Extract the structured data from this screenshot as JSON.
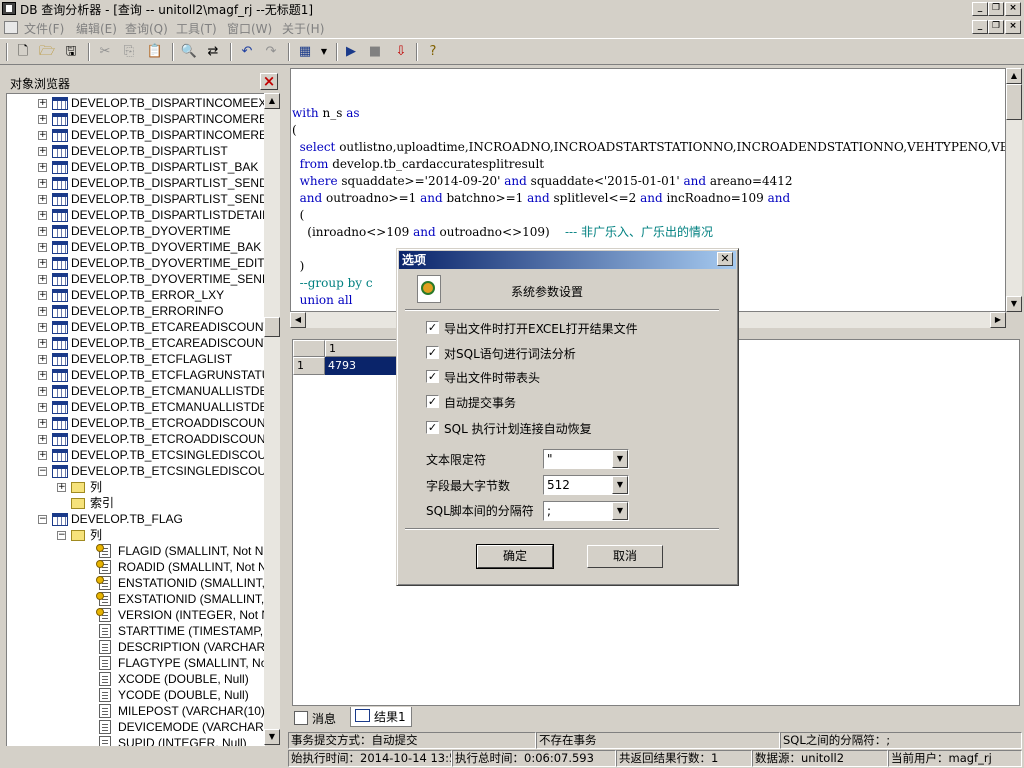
{
  "window": {
    "title": "DB 查询分析器 - [查询 -- unitoll2\\magf_rj  --无标题1]"
  },
  "menu": [
    "文件(F)",
    "编辑(E)",
    "查询(Q)",
    "工具(T)",
    "窗口(W)",
    "关于(H)"
  ],
  "object_browser": {
    "title": "对象浏览器",
    "items": [
      {
        "type": "table",
        "label": "DEVELOP.TB_DISPARTINCOMEEX",
        "level": 0,
        "exp": "+"
      },
      {
        "type": "table",
        "label": "DEVELOP.TB_DISPARTINCOMERE",
        "level": 0,
        "exp": "+"
      },
      {
        "type": "table",
        "label": "DEVELOP.TB_DISPARTINCOMERE",
        "level": 0,
        "exp": "+"
      },
      {
        "type": "table",
        "label": "DEVELOP.TB_DISPARTLIST",
        "level": 0,
        "exp": "+"
      },
      {
        "type": "table",
        "label": "DEVELOP.TB_DISPARTLIST_BAK",
        "level": 0,
        "exp": "+"
      },
      {
        "type": "table",
        "label": "DEVELOP.TB_DISPARTLIST_SEND",
        "level": 0,
        "exp": "+"
      },
      {
        "type": "table",
        "label": "DEVELOP.TB_DISPARTLIST_SEND",
        "level": 0,
        "exp": "+"
      },
      {
        "type": "table",
        "label": "DEVELOP.TB_DISPARTLISTDETAIL",
        "level": 0,
        "exp": "+"
      },
      {
        "type": "table",
        "label": "DEVELOP.TB_DYOVERTIME",
        "level": 0,
        "exp": "+"
      },
      {
        "type": "table",
        "label": "DEVELOP.TB_DYOVERTIME_BAK",
        "level": 0,
        "exp": "+"
      },
      {
        "type": "table",
        "label": "DEVELOP.TB_DYOVERTIME_EDIT",
        "level": 0,
        "exp": "+"
      },
      {
        "type": "table",
        "label": "DEVELOP.TB_DYOVERTIME_SEND",
        "level": 0,
        "exp": "+"
      },
      {
        "type": "table",
        "label": "DEVELOP.TB_ERROR_LXY",
        "level": 0,
        "exp": "+"
      },
      {
        "type": "table",
        "label": "DEVELOP.TB_ERRORINFO",
        "level": 0,
        "exp": "+"
      },
      {
        "type": "table",
        "label": "DEVELOP.TB_ETCAREADISCOUNT",
        "level": 0,
        "exp": "+"
      },
      {
        "type": "table",
        "label": "DEVELOP.TB_ETCAREADISCOUNT",
        "level": 0,
        "exp": "+"
      },
      {
        "type": "table",
        "label": "DEVELOP.TB_ETCFLAGLIST",
        "level": 0,
        "exp": "+"
      },
      {
        "type": "table",
        "label": "DEVELOP.TB_ETCFLAGRUNSTATU",
        "level": 0,
        "exp": "+"
      },
      {
        "type": "table",
        "label": "DEVELOP.TB_ETCMANUALLISTDE",
        "level": 0,
        "exp": "+"
      },
      {
        "type": "table",
        "label": "DEVELOP.TB_ETCMANUALLISTDE",
        "level": 0,
        "exp": "+"
      },
      {
        "type": "table",
        "label": "DEVELOP.TB_ETCROADDISCOUNT",
        "level": 0,
        "exp": "+"
      },
      {
        "type": "table",
        "label": "DEVELOP.TB_ETCROADDISCOUNT",
        "level": 0,
        "exp": "+"
      },
      {
        "type": "table",
        "label": "DEVELOP.TB_ETCSINGLEDISCOUN",
        "level": 0,
        "exp": "+"
      },
      {
        "type": "table",
        "label": "DEVELOP.TB_ETCSINGLEDISCOUN",
        "level": 0,
        "exp": "-"
      },
      {
        "type": "folder",
        "label": "列",
        "level": 1,
        "exp": "+"
      },
      {
        "type": "folder",
        "label": "索引",
        "level": 1,
        "exp": ""
      },
      {
        "type": "table",
        "label": "DEVELOP.TB_FLAG",
        "level": 0,
        "exp": "-"
      },
      {
        "type": "folder",
        "label": "列",
        "level": 1,
        "exp": "-"
      },
      {
        "type": "key",
        "label": "FLAGID (SMALLINT, Not Nul",
        "level": 2,
        "exp": ""
      },
      {
        "type": "key",
        "label": "ROADID (SMALLINT, Not Nu",
        "level": 2,
        "exp": ""
      },
      {
        "type": "key",
        "label": "ENSTATIONID (SMALLINT, N",
        "level": 2,
        "exp": ""
      },
      {
        "type": "key",
        "label": "EXSTATIONID (SMALLINT, N",
        "level": 2,
        "exp": ""
      },
      {
        "type": "key",
        "label": "VERSION (INTEGER, Not Nu",
        "level": 2,
        "exp": ""
      },
      {
        "type": "col",
        "label": "STARTTIME (TIMESTAMP, N",
        "level": 2,
        "exp": ""
      },
      {
        "type": "col",
        "label": "DESCRIPTION (VARCHAR(3",
        "level": 2,
        "exp": ""
      },
      {
        "type": "col",
        "label": "FLAGTYPE (SMALLINT, Not",
        "level": 2,
        "exp": ""
      },
      {
        "type": "col",
        "label": "XCODE (DOUBLE, Null)",
        "level": 2,
        "exp": ""
      },
      {
        "type": "col",
        "label": "YCODE (DOUBLE, Null)",
        "level": 2,
        "exp": ""
      },
      {
        "type": "col",
        "label": "MILEPOST (VARCHAR(10), N",
        "level": 2,
        "exp": ""
      },
      {
        "type": "col",
        "label": "DEVICEMODE (VARCHAR(2(",
        "level": 2,
        "exp": ""
      },
      {
        "type": "col",
        "label": "SUPID (INTEGER, Null)",
        "level": 2,
        "exp": ""
      }
    ]
  },
  "editor": {
    "lines": [
      [
        {
          "t": "with",
          "c": "kw"
        },
        {
          "t": " n_s ",
          "c": ""
        },
        {
          "t": "as",
          "c": "kw"
        }
      ],
      [
        {
          "t": "(",
          "c": ""
        }
      ],
      [
        {
          "t": "  select",
          "c": "kw"
        },
        {
          "t": " outlistno,uploadtime,INCROADNO,INCROADSTARTSTATIONNO,INCROADENDSTATIONNO,VEHTYPENO,VEHCLASSNO",
          "c": ""
        }
      ],
      [
        {
          "t": "  from",
          "c": "kw"
        },
        {
          "t": " develop.tb_cardaccuratesplitresult",
          "c": ""
        }
      ],
      [
        {
          "t": "  where",
          "c": "kw"
        },
        {
          "t": " squaddate>='2014-09-20' ",
          "c": ""
        },
        {
          "t": "and",
          "c": "kw"
        },
        {
          "t": " squaddate<'2015-01-01' ",
          "c": ""
        },
        {
          "t": "and",
          "c": "kw"
        },
        {
          "t": " areano=4412",
          "c": ""
        }
      ],
      [
        {
          "t": "  and",
          "c": "kw"
        },
        {
          "t": " outroadno>=1 ",
          "c": ""
        },
        {
          "t": "and",
          "c": "kw"
        },
        {
          "t": " batchno>=1 ",
          "c": ""
        },
        {
          "t": "and",
          "c": "kw"
        },
        {
          "t": " splitlevel<=2 ",
          "c": ""
        },
        {
          "t": "and",
          "c": "kw"
        },
        {
          "t": " incRoadno=109 ",
          "c": ""
        },
        {
          "t": "and",
          "c": "kw"
        }
      ],
      [
        {
          "t": "  (",
          "c": ""
        }
      ],
      [
        {
          "t": "    (inroadno<>109 ",
          "c": ""
        },
        {
          "t": "and",
          "c": "kw"
        },
        {
          "t": " outroadno<>109)    ",
          "c": ""
        },
        {
          "t": "--- 非广乐入、广乐出的情况",
          "c": "cmt"
        }
      ],
      [
        {
          "t": "",
          "c": ""
        }
      ],
      [
        {
          "t": "  )",
          "c": ""
        }
      ],
      [
        {
          "t": "  --group by c",
          "c": "cmt"
        }
      ],
      [
        {
          "t": "  union all",
          "c": "kw"
        }
      ]
    ]
  },
  "results": {
    "column_header": "1",
    "row_number": "1",
    "cell_value": "4793"
  },
  "result_tabs": {
    "messages": "消息",
    "results": "结果1"
  },
  "status": {
    "commit_mode": "事务提交方式：自动提交",
    "transaction": "不存在事务",
    "separator": "SQL之间的分隔符：;",
    "start_time": "始执行时间：2014-10-14 13:50:",
    "total_time": "执行总时间：0:06:07.593",
    "row_count": "共返回结果行数：1",
    "datasource": "数据源：unitoll2",
    "current_user": "当前用户：magf_rj"
  },
  "dialog": {
    "title": "选项",
    "heading": "系统参数设置",
    "options": [
      {
        "label": "导出文件时打开EXCEL打开结果文件",
        "checked": true
      },
      {
        "label": "对SQL语句进行词法分析",
        "checked": true
      },
      {
        "label": "导出文件时带表头",
        "checked": true
      },
      {
        "label": "自动提交事务",
        "checked": true
      },
      {
        "label": "SQL 执行计划连接自动恢复",
        "checked": true
      }
    ],
    "text_qualifier_label": "文本限定符",
    "text_qualifier_value": "\"",
    "max_bytes_label": "字段最大字节数",
    "max_bytes_value": "512",
    "script_sep_label": "SQL脚本间的分隔符",
    "script_sep_value": ";",
    "ok_label": "确定",
    "cancel_label": "取消"
  }
}
